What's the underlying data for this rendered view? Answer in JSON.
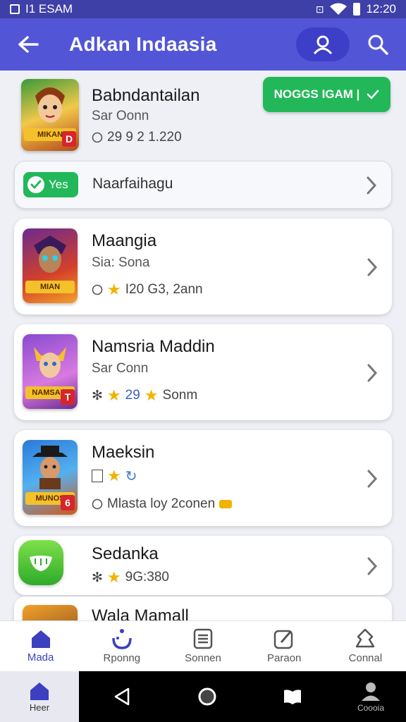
{
  "status_bar": {
    "left_text": "I1 ESAM",
    "time": "12:20"
  },
  "app_bar": {
    "title": "Adkan Indaasia"
  },
  "featured": {
    "title": "Babndantailan",
    "subtitle": "Sar Oonn",
    "meta": "29 9 2 1.220",
    "thumb_banner": "MIKAN",
    "thumb_badge": "D",
    "action_label": "NOGGS IGAM |"
  },
  "mini_card": {
    "pill_label": "Yes",
    "label": "Naarfaihagu"
  },
  "items": [
    {
      "title": "Maangia",
      "subtitle": "Sia: Sona",
      "meta": "I20 G3, 2ann",
      "thumb_banner": "MIAN"
    },
    {
      "title": "Namsria Maddin",
      "subtitle": "Sar Conn",
      "meta_num": "29",
      "meta_text": "Sonm",
      "thumb_banner": "NAMSARI",
      "thumb_badge": "T"
    },
    {
      "title": "Maeksin",
      "subtitle": "",
      "meta": "Mlasta loy 2conen",
      "thumb_banner": "MUNOS",
      "thumb_badge": "6"
    },
    {
      "title": "Sedanka",
      "subtitle": "",
      "meta": "9G:380"
    },
    {
      "title": "Wala Mamall"
    }
  ],
  "bottom_nav": [
    {
      "label": "Mada"
    },
    {
      "label": "Rponng"
    },
    {
      "label": "Sonnen"
    },
    {
      "label": "Paraon"
    },
    {
      "label": "Connal"
    }
  ],
  "system_nav": {
    "home_label": "Heer",
    "profile_label": "Coooia"
  },
  "colors": {
    "accent": "#5256d6",
    "green": "#22b85a",
    "star": "#f0b400"
  }
}
